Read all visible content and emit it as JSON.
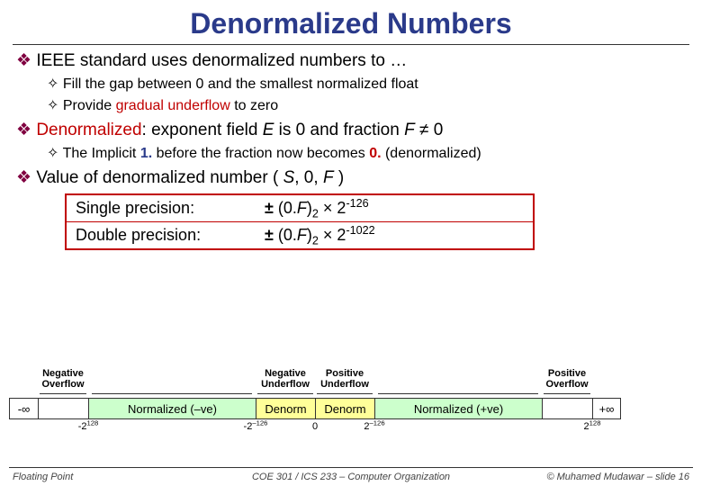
{
  "title": "Denormalized Numbers",
  "bullets": {
    "b1a": "IEEE standard uses denormalized numbers to …",
    "b2a": "Fill the gap between 0 and the smallest normalized float",
    "b2b_pre": "Provide ",
    "b2b_red": "gradual underflow",
    "b2b_post": " to zero",
    "b1b_pre": "Denormalized",
    "b1b_mid": ": exponent field ",
    "b1b_e": "E",
    "b1b_mid2": " is 0 and fraction ",
    "b1b_f": "F",
    "b1b_post": " ≠ 0",
    "b2c_pre": "The Implicit ",
    "b2c_one": "1.",
    "b2c_mid": " before the fraction now becomes ",
    "b2c_zero": "0.",
    "b2c_post": " (denormalized)",
    "b1c_pre": "Value of denormalized number ( ",
    "b1c_s": "S",
    "b1c_mid": ", 0, ",
    "b1c_f": "F",
    "b1c_post": " )"
  },
  "box": {
    "sp_label": "Single precision:",
    "sp_val_pm": "±",
    "sp_val_a": " (0.",
    "sp_val_f": "F",
    "sp_val_b": ")",
    "sp_val_sub": "2",
    "sp_val_mul": " × 2",
    "sp_val_exp": "-126",
    "dp_label": "Double precision:",
    "dp_val_exp": "-1022"
  },
  "numberline": {
    "neg_overflow": "Negative\nOverflow",
    "neg_underflow": "Negative\nUnderflow",
    "pos_underflow": "Positive\nUnderflow",
    "pos_overflow": "Positive\nOverflow",
    "neg_inf": "-∞",
    "pos_inf": "+∞",
    "norm_neg": "Normalized (–ve)",
    "norm_pos": "Normalized (+ve)",
    "denorm": "Denorm",
    "tick_neg2_128": "-2",
    "tick_neg2_128_sup": "128",
    "tick_neg2_m126": "-2",
    "tick_neg2_m126_sup": "–126",
    "tick_zero": "0",
    "tick_2_m126": "2",
    "tick_2_m126_sup": "–126",
    "tick_2_128": "2",
    "tick_2_128_sup": "128"
  },
  "footer": {
    "left": "Floating Point",
    "center": "COE 301 / ICS 233 – Computer Organization",
    "right": "© Muhamed Mudawar – slide 16"
  }
}
